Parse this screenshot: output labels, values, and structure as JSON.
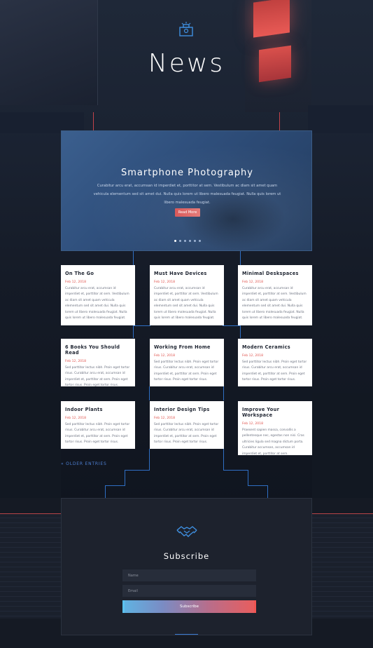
{
  "header": {
    "icon": "light-toolbox-icon",
    "title": "News"
  },
  "hero": {
    "title": "Smartphone Photography",
    "text": "Curabitur arcu erat, accumsan id imperdiet et, porttitor at sem. Vestibulum ac diam sit amet quam vehicula elementum sed sit amet dui. Nulla quis lorem ut libero malesuada feugiat. Nulla quis lorem ut libero malesuada feugiat.",
    "button": "Read More",
    "slide_count": 6,
    "active_slide": 1
  },
  "posts": [
    {
      "title": "On The Go",
      "date": "Feb 12, 2018",
      "excerpt": "Curabitur arcu erat, accumsan id imperdiet et, porttitor at sem. Vestibulum ac diam sit amet quam vehicula elementum sed sit amet dui. Nulla quis lorem ut libero malesuada feugiat. Nulla quis lorem ut libero malesuada feugiat."
    },
    {
      "title": "Must Have Devices",
      "date": "Feb 12, 2018",
      "excerpt": "Curabitur arcu erat, accumsan id imperdiet et, porttitor at sem. Vestibulum ac diam sit amet quam vehicula elementum sed sit amet dui. Nulla quis lorem ut libero malesuada feugiat. Nulla quis lorem ut libero malesuada feugiat."
    },
    {
      "title": "Minimal Deskspaces",
      "date": "Feb 12, 2018",
      "excerpt": "Curabitur arcu erat, accumsan id imperdiet et, porttitor at sem. Vestibulum ac diam sit amet quam vehicula elementum sed sit amet dui. Nulla quis lorem ut libero malesuada feugiat. Nulla quis lorem ut libero malesuada feugiat."
    },
    {
      "title": "6 Books You Should Read",
      "date": "Feb 12, 2018",
      "excerpt": "Sed porttitor lectus nibh. Proin eget tortor risus. Curabitur arcu erat, accumsan id imperdiet et, porttitor at sem. Proin eget tortor risus. Proin eget tortor risus."
    },
    {
      "title": "Working From Home",
      "date": "Feb 12, 2018",
      "excerpt": "Sed porttitor lectus nibh. Proin eget tortor risus. Curabitur arcu erat, accumsan id imperdiet et, porttitor at sem. Proin eget tortor risus. Proin eget tortor risus."
    },
    {
      "title": "Modern Ceramics",
      "date": "Feb 12, 2018",
      "excerpt": "Sed porttitor lectus nibh. Proin eget tortor risus. Curabitur arcu erat, accumsan id imperdiet et, porttitor at sem. Proin eget tortor risus. Proin eget tortor risus."
    },
    {
      "title": "Indoor Plants",
      "date": "Feb 12, 2018",
      "excerpt": "Sed porttitor lectus nibh. Proin eget tortor risus. Curabitur arcu erat, accumsan id imperdiet et, porttitor at sem. Proin eget tortor risus. Proin eget tortor risus."
    },
    {
      "title": "Interior Design Tips",
      "date": "Feb 12, 2018",
      "excerpt": "Sed porttitor lectus nibh. Proin eget tortor risus. Curabitur arcu erat, accumsan id imperdiet et, porttitor at sem. Proin eget tortor risus. Proin eget tortor risus."
    },
    {
      "title": "Improve Your Workspace",
      "date": "Feb 12, 2018",
      "excerpt": "Praesent sapien massa, convallis a pellentesque nec, egestas non nisi. Cras ultricies ligula sed magna dictum porta. Curabitur accumsan, accumsan id imperdiet et, porttitor at sem."
    }
  ],
  "pagination": {
    "older": "« OLDER ENTRIES"
  },
  "subscribe": {
    "icon": "handshake-icon",
    "title": "Subscribe",
    "name_placeholder": "Name",
    "email_placeholder": "Email",
    "button": "Subscribe"
  },
  "colors": {
    "accent_red": "#e0554f",
    "accent_blue": "#4d7fd1",
    "background": "#141a26"
  }
}
